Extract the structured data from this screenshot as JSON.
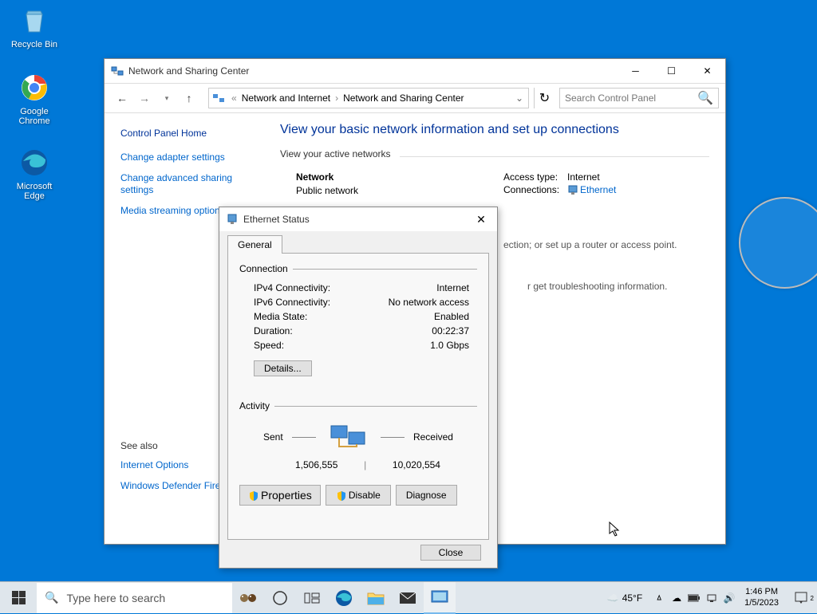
{
  "desktop": {
    "icons": [
      {
        "name": "recycle-bin",
        "label": "Recycle Bin"
      },
      {
        "name": "google-chrome",
        "label": "Google\nChrome"
      },
      {
        "name": "microsoft-edge",
        "label": "Microsoft\nEdge"
      }
    ]
  },
  "control_panel": {
    "title": "Network and Sharing Center",
    "breadcrumb": {
      "parent": "Network and Internet",
      "current": "Network and Sharing Center"
    },
    "search_placeholder": "Search Control Panel",
    "sidebar": {
      "home": "Control Panel Home",
      "links": [
        "Change adapter settings",
        "Change advanced sharing settings",
        "Media streaming options"
      ],
      "see_also_label": "See also",
      "see_also": [
        "Internet Options",
        "Windows Defender Firewall"
      ]
    },
    "main": {
      "heading": "View your basic network information and set up connections",
      "active_label": "View your active networks",
      "network": {
        "name": "Network",
        "type": "Public network",
        "access_label": "Access type:",
        "access_value": "Internet",
        "conn_label": "Connections:",
        "conn_value": "Ethernet"
      },
      "change_hint": "ection; or set up a router or access point.",
      "trouble_hint": "r get troubleshooting information."
    }
  },
  "ethernet_status": {
    "title": "Ethernet Status",
    "tab": "General",
    "connection_label": "Connection",
    "rows": {
      "ipv4_label": "IPv4 Connectivity:",
      "ipv4_value": "Internet",
      "ipv6_label": "IPv6 Connectivity:",
      "ipv6_value": "No network access",
      "media_label": "Media State:",
      "media_value": "Enabled",
      "duration_label": "Duration:",
      "duration_value": "00:22:37",
      "speed_label": "Speed:",
      "speed_value": "1.0 Gbps"
    },
    "details_btn": "Details...",
    "activity_label": "Activity",
    "activity": {
      "sent_label": "Sent",
      "received_label": "Received",
      "sent_value": "1,506,555",
      "received_value": "10,020,554"
    },
    "buttons": {
      "properties": "Properties",
      "disable": "Disable",
      "diagnose": "Diagnose",
      "close": "Close"
    }
  },
  "taskbar": {
    "search_placeholder": "Type here to search",
    "weather": "45°F",
    "time": "1:46 PM",
    "date": "1/5/2023"
  }
}
